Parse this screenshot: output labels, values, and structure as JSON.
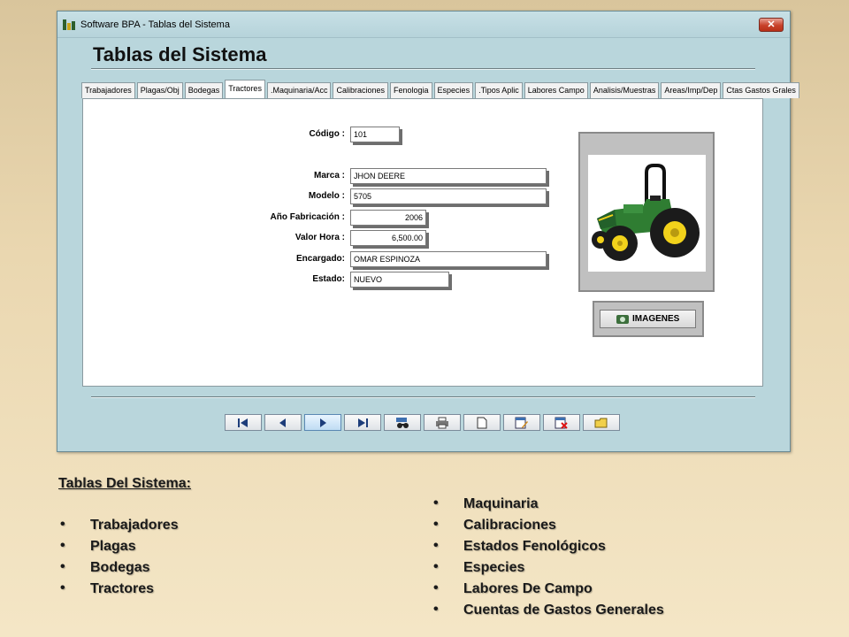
{
  "window": {
    "title": "Software BPA - Tablas del Sistema",
    "close_label": "✕",
    "form_title": "Tablas del Sistema"
  },
  "tabs": [
    {
      "label": "Trabajadores"
    },
    {
      "label": "Plagas/Obj"
    },
    {
      "label": "Bodegas"
    },
    {
      "label": "Tractores",
      "active": true
    },
    {
      "label": ".Maquinaria/Acc"
    },
    {
      "label": "Calibraciones"
    },
    {
      "label": "Fenologia"
    },
    {
      "label": "Especies"
    },
    {
      "label": ".Tipos Aplic"
    },
    {
      "label": "Labores Campo"
    },
    {
      "label": "Analisis/Muestras"
    },
    {
      "label": "Areas/Imp/Dep"
    },
    {
      "label": "Ctas Gastos Grales"
    }
  ],
  "fields": {
    "codigo": {
      "label": "Código :",
      "value": "101"
    },
    "marca": {
      "label": "Marca :",
      "value": "JHON DEERE"
    },
    "modelo": {
      "label": "Modelo :",
      "value": "5705"
    },
    "anio": {
      "label": "Año Fabricación :",
      "value": "2006"
    },
    "valor_hora": {
      "label": "Valor Hora :",
      "value": "6,500.00"
    },
    "encargado": {
      "label": "Encargado:",
      "value": "OMAR ESPINOZA"
    },
    "estado": {
      "label": "Estado:",
      "value": "NUEVO"
    }
  },
  "image_button": {
    "label": "IMAGENES",
    "icon": "camera-icon"
  },
  "toolbar": {
    "buttons": [
      {
        "name": "first-record",
        "icon": "first-icon"
      },
      {
        "name": "previous-record",
        "icon": "previous-icon"
      },
      {
        "name": "next-record",
        "icon": "next-icon"
      },
      {
        "name": "last-record",
        "icon": "last-icon"
      },
      {
        "name": "search",
        "icon": "binoculars-icon"
      },
      {
        "name": "print",
        "icon": "printer-icon"
      },
      {
        "name": "new",
        "icon": "new-document-icon"
      },
      {
        "name": "edit",
        "icon": "edit-icon"
      },
      {
        "name": "delete",
        "icon": "delete-icon"
      },
      {
        "name": "open",
        "icon": "folder-icon"
      }
    ]
  },
  "caption": {
    "title": "Tablas Del Sistema:",
    "list_left": [
      "Trabajadores",
      "Plagas",
      "Bodegas",
      "Tractores"
    ],
    "list_right": [
      "Maquinaria",
      "Calibraciones",
      "Estados Fenológicos",
      "Especies",
      "Labores De Campo",
      "Cuentas de Gastos Generales"
    ]
  },
  "colors": {
    "window_bg": "#b9d6dc",
    "tractor_green": "#2f7d32",
    "tractor_yellow": "#f2d21b",
    "close_red": "#c8412a"
  }
}
